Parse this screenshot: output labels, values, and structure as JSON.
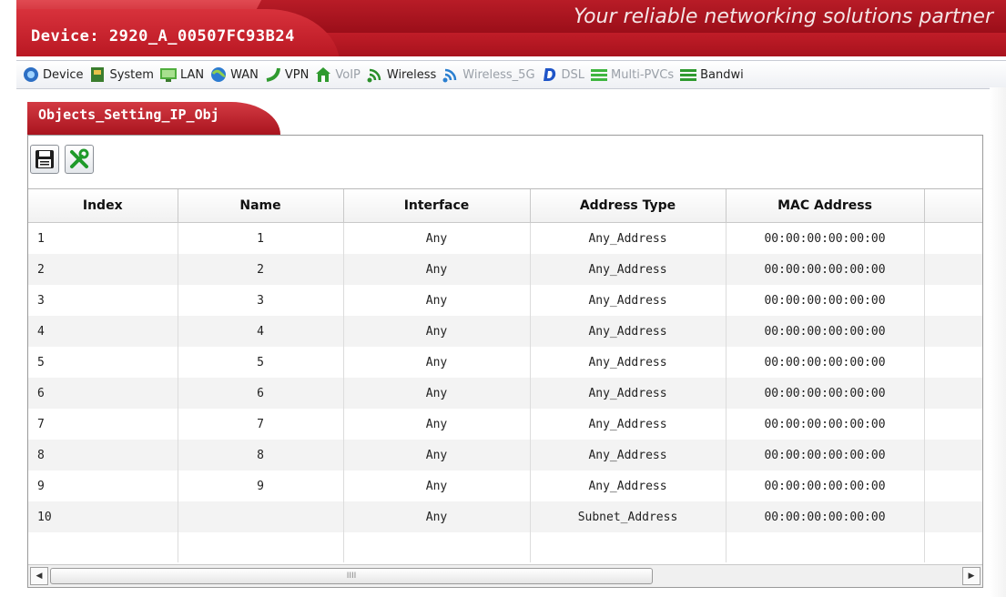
{
  "header": {
    "device_title": "Device: 2920_A_00507FC93B24",
    "slogan": "Your reliable networking solutions partner"
  },
  "toolbar": {
    "items": [
      {
        "label": "Device",
        "icon": "device-icon",
        "enabled": true
      },
      {
        "label": "System",
        "icon": "system-icon",
        "enabled": true
      },
      {
        "label": "LAN",
        "icon": "lan-icon",
        "enabled": true
      },
      {
        "label": "WAN",
        "icon": "wan-icon",
        "enabled": true
      },
      {
        "label": "VPN",
        "icon": "vpn-icon",
        "enabled": true
      },
      {
        "label": "VoIP",
        "icon": "voip-icon",
        "enabled": false
      },
      {
        "label": "Wireless",
        "icon": "wireless-icon",
        "enabled": true
      },
      {
        "label": "Wireless_5G",
        "icon": "wireless-5g-icon",
        "enabled": false
      },
      {
        "label": "DSL",
        "icon": "dsl-icon",
        "enabled": false
      },
      {
        "label": "Multi-PVCs",
        "icon": "multi-pvcs-icon",
        "enabled": false
      },
      {
        "label": "Bandwi",
        "icon": "bandwidth-icon",
        "enabled": true
      }
    ]
  },
  "section": {
    "title": "Objects_Setting_IP_Obj"
  },
  "actions": {
    "save_icon": "save-icon",
    "tools_icon": "tools-icon"
  },
  "grid": {
    "columns": [
      "Index",
      "Name",
      "Interface",
      "Address Type",
      "MAC Address",
      ""
    ],
    "rows": [
      [
        "1",
        "1",
        "Any",
        "Any_Address",
        "00:00:00:00:00:00"
      ],
      [
        "2",
        "2",
        "Any",
        "Any_Address",
        "00:00:00:00:00:00"
      ],
      [
        "3",
        "3",
        "Any",
        "Any_Address",
        "00:00:00:00:00:00"
      ],
      [
        "4",
        "4",
        "Any",
        "Any_Address",
        "00:00:00:00:00:00"
      ],
      [
        "5",
        "5",
        "Any",
        "Any_Address",
        "00:00:00:00:00:00"
      ],
      [
        "6",
        "6",
        "Any",
        "Any_Address",
        "00:00:00:00:00:00"
      ],
      [
        "7",
        "7",
        "Any",
        "Any_Address",
        "00:00:00:00:00:00"
      ],
      [
        "8",
        "8",
        "Any",
        "Any_Address",
        "00:00:00:00:00:00"
      ],
      [
        "9",
        "9",
        "Any",
        "Any_Address",
        "00:00:00:00:00:00"
      ],
      [
        "10",
        "",
        "Any",
        "Subnet_Address",
        "00:00:00:00:00:00"
      ],
      [
        "",
        "",
        "",
        "",
        ""
      ]
    ]
  },
  "scrollbar": {
    "grip": "IIII"
  },
  "colors": {
    "brand_red": "#c7202b",
    "disabled_text": "#9aa0a8"
  }
}
